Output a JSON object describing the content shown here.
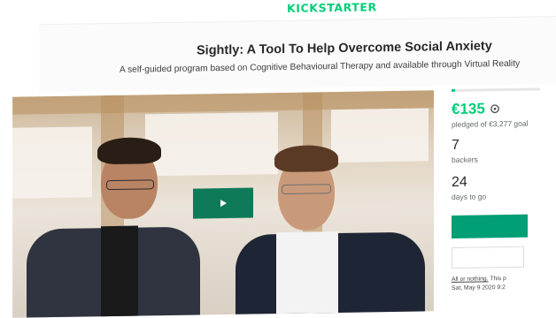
{
  "brand": {
    "logo_text": "KICKSTARTER",
    "accent": "#05ce78"
  },
  "project": {
    "title": "Sightly: A Tool To Help Overcome Social Anxiety",
    "subtitle": "A self-guided program based on Cognitive Behavioural Therapy and available through Virtual Reality"
  },
  "video": {
    "play_icon": "play-icon",
    "button_color": "#0f7a5a"
  },
  "stats": {
    "pledged": "€135",
    "pledged_label": "pledged of €3,277 goal",
    "funded_fraction": 0.04,
    "backers": "7",
    "backers_label": "backers",
    "days": "24",
    "days_label": "days to go"
  },
  "fine_print": {
    "link": "All or nothing.",
    "text": "This p",
    "date": "Sat, May 9 2020 9:2"
  },
  "icons": {
    "currency": "refresh-icon"
  }
}
